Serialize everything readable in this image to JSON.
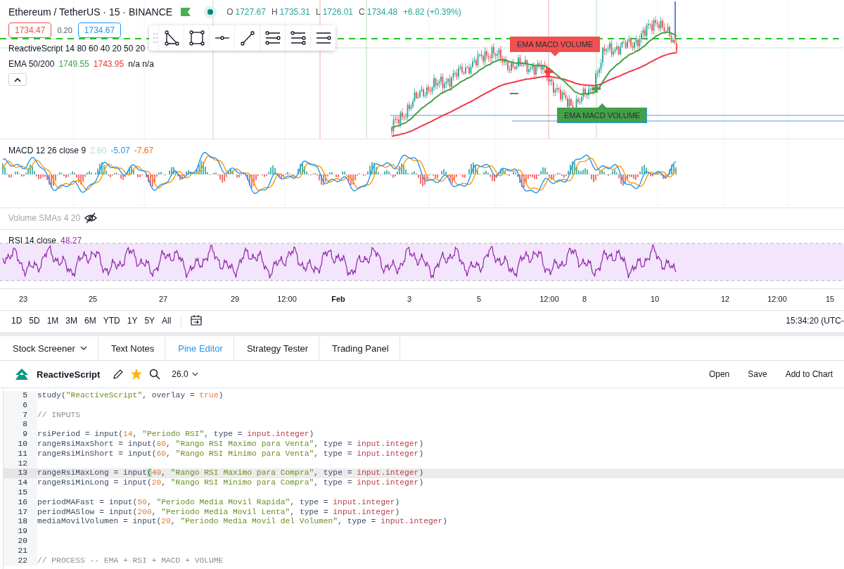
{
  "chart": {
    "symbol": "Ethereum / TetherUS · 15 · BINANCE",
    "ohlc": [
      {
        "label": "O",
        "value": "1727.67"
      },
      {
        "label": "H",
        "value": "1735.31"
      },
      {
        "label": "L",
        "value": "1726.01"
      },
      {
        "label": "C",
        "value": "1734.48"
      }
    ],
    "change": "+6.82 (+0.39%)",
    "sell_price": "1734.47",
    "spread": "0.20",
    "buy_price": "1734.67",
    "script_legend": "ReactiveScript 14 80 60 40 20 50 20",
    "ema_legend": {
      "name": "EMA 50/200",
      "values": [
        {
          "text": "1749.55",
          "color": "#43a047"
        },
        {
          "text": "1743.95",
          "color": "#e53935"
        },
        {
          "text": "n/a n/a",
          "color": "#131722"
        }
      ]
    },
    "signals": [
      {
        "kind": "sell",
        "label": "EMA MACD VOLUME"
      },
      {
        "kind": "buy",
        "label": "EMA MACD VOLUME"
      }
    ]
  },
  "macd": {
    "name": "MACD 12 26 close 9",
    "values": [
      {
        "text": "2.60",
        "color": "#b2dfdb"
      },
      {
        "text": "-5.07",
        "color": "#2196f3"
      },
      {
        "text": "-7.67",
        "color": "#ff6d00"
      }
    ]
  },
  "volume": {
    "name": "Volume SMAs 4 20",
    "hidden": true
  },
  "rsi": {
    "name": "RSI 14 close",
    "values": [
      {
        "text": "48.27",
        "color": "#9c27b0"
      }
    ]
  },
  "time_axis": [
    {
      "label": "23",
      "bold": false
    },
    {
      "label": "25",
      "bold": false
    },
    {
      "label": "27",
      "bold": false
    },
    {
      "label": "29",
      "bold": false
    },
    {
      "label": "12:00",
      "bold": false
    },
    {
      "label": "Feb",
      "bold": true
    },
    {
      "label": "3",
      "bold": false
    },
    {
      "label": "5",
      "bold": false
    },
    {
      "label": "12:00",
      "bold": false
    },
    {
      "label": "8",
      "bold": false
    },
    {
      "label": "10",
      "bold": false
    },
    {
      "label": "12",
      "bold": false
    },
    {
      "label": "12:00",
      "bold": false
    },
    {
      "label": "15",
      "bold": false
    }
  ],
  "ranges": [
    "1D",
    "5D",
    "1M",
    "3M",
    "6M",
    "YTD",
    "1Y",
    "5Y",
    "All"
  ],
  "clock": "15:34:20 (UTC-",
  "bottom_tabs": [
    {
      "label": "Stock Screener",
      "has_menu": true,
      "selected": false
    },
    {
      "label": "Text Notes",
      "has_menu": false,
      "selected": false
    },
    {
      "label": "Pine Editor",
      "has_menu": false,
      "selected": true
    },
    {
      "label": "Strategy Tester",
      "has_menu": false,
      "selected": false
    },
    {
      "label": "Trading Panel",
      "has_menu": false,
      "selected": false
    }
  ],
  "editor": {
    "script_name": "ReactiveScript",
    "favorite": true,
    "version": "26.0",
    "actions": [
      "Open",
      "Save",
      "Add to Chart"
    ],
    "lines": [
      {
        "number": "5",
        "current": false,
        "tokens": [
          {
            "kind": "plain",
            "text": "study("
          },
          {
            "kind": "string",
            "text": "\"ReactiveScript\""
          },
          {
            "kind": "plain",
            "text": ", overlay = "
          },
          {
            "kind": "literal",
            "text": "true"
          },
          {
            "kind": "plain",
            "text": ")"
          }
        ]
      },
      {
        "number": "6",
        "current": false
      },
      {
        "number": "7",
        "current": false,
        "tokens": [
          {
            "kind": "comment",
            "text": "// INPUTS"
          }
        ]
      },
      {
        "number": "8",
        "current": false
      },
      {
        "number": "9",
        "current": false,
        "tokens": [
          {
            "kind": "plain",
            "text": "rsiPeriod = input("
          },
          {
            "kind": "literal",
            "text": "14"
          },
          {
            "kind": "plain",
            "text": ", "
          },
          {
            "kind": "string",
            "text": "\"Periodo RSI\""
          },
          {
            "kind": "plain",
            "text": ", type = "
          },
          {
            "kind": "keyword",
            "text": "input.integer"
          },
          {
            "kind": "plain",
            "text": ")"
          }
        ]
      },
      {
        "number": "10",
        "current": false,
        "tokens": [
          {
            "kind": "plain",
            "text": "rangeRsiMaxShort = input("
          },
          {
            "kind": "literal",
            "text": "80"
          },
          {
            "kind": "plain",
            "text": ", "
          },
          {
            "kind": "string",
            "text": "\"Rango RSI Maximo para Venta\""
          },
          {
            "kind": "plain",
            "text": ", type = "
          },
          {
            "kind": "keyword",
            "text": "input.integer"
          },
          {
            "kind": "plain",
            "text": ")"
          }
        ]
      },
      {
        "number": "11",
        "current": false,
        "tokens": [
          {
            "kind": "plain",
            "text": "rangeRsiMinShort = input("
          },
          {
            "kind": "literal",
            "text": "60"
          },
          {
            "kind": "plain",
            "text": ", "
          },
          {
            "kind": "string",
            "text": "\"Rango RSI Minimo para Venta\""
          },
          {
            "kind": "plain",
            "text": ", type = "
          },
          {
            "kind": "keyword",
            "text": "input.integer"
          },
          {
            "kind": "plain",
            "text": ")"
          }
        ]
      },
      {
        "number": "12",
        "current": false
      },
      {
        "number": "13",
        "current": true,
        "tokens": [
          {
            "kind": "plain",
            "text": "rangeRsiMaxLong = input"
          },
          {
            "kind": "match",
            "text": "("
          },
          {
            "kind": "literal",
            "text": "40"
          },
          {
            "kind": "plain",
            "text": ", "
          },
          {
            "kind": "string",
            "text": "\"Rango RSI Maximo para Compra\""
          },
          {
            "kind": "plain",
            "text": ", type = "
          },
          {
            "kind": "keyword",
            "text": "input.integer"
          },
          {
            "kind": "plain",
            "text": ")"
          }
        ]
      },
      {
        "number": "14",
        "current": false,
        "tokens": [
          {
            "kind": "plain",
            "text": "rangeRsiMinLong = input("
          },
          {
            "kind": "literal",
            "text": "20"
          },
          {
            "kind": "plain",
            "text": ", "
          },
          {
            "kind": "string",
            "text": "\"Rango RSI Minimo para Compra\""
          },
          {
            "kind": "plain",
            "text": ", type = "
          },
          {
            "kind": "keyword",
            "text": "input.integer"
          },
          {
            "kind": "plain",
            "text": ")"
          }
        ]
      },
      {
        "number": "15",
        "current": false
      },
      {
        "number": "16",
        "current": false,
        "tokens": [
          {
            "kind": "plain",
            "text": "periodMAFast = input("
          },
          {
            "kind": "literal",
            "text": "50"
          },
          {
            "kind": "plain",
            "text": ", "
          },
          {
            "kind": "string",
            "text": "\"Periodo Media Movil Rapida\""
          },
          {
            "kind": "plain",
            "text": ", type = "
          },
          {
            "kind": "keyword",
            "text": "input.integer"
          },
          {
            "kind": "plain",
            "text": ")"
          }
        ]
      },
      {
        "number": "17",
        "current": false,
        "tokens": [
          {
            "kind": "plain",
            "text": "periodMASlow = input("
          },
          {
            "kind": "literal",
            "text": "200"
          },
          {
            "kind": "plain",
            "text": ", "
          },
          {
            "kind": "string",
            "text": "\"Periodo Media Movil Lenta\""
          },
          {
            "kind": "plain",
            "text": ", type = "
          },
          {
            "kind": "keyword",
            "text": "input.integer"
          },
          {
            "kind": "plain",
            "text": ")"
          }
        ]
      },
      {
        "number": "18",
        "current": false,
        "tokens": [
          {
            "kind": "plain",
            "text": "mediaMovilVolumen = input("
          },
          {
            "kind": "literal",
            "text": "20"
          },
          {
            "kind": "plain",
            "text": ", "
          },
          {
            "kind": "string",
            "text": "\"Periodo Media Movil del Volumen\""
          },
          {
            "kind": "plain",
            "text": ", type = "
          },
          {
            "kind": "keyword",
            "text": "input.integer"
          },
          {
            "kind": "plain",
            "text": ")"
          }
        ]
      },
      {
        "number": "19",
        "current": false
      },
      {
        "number": "20",
        "current": false
      },
      {
        "number": "21",
        "current": false
      },
      {
        "number": "22",
        "current": false,
        "tokens": [
          {
            "kind": "comment",
            "text": "// PROCESS -- EMA + RSI + MACD + VOLUME"
          }
        ]
      }
    ]
  }
}
